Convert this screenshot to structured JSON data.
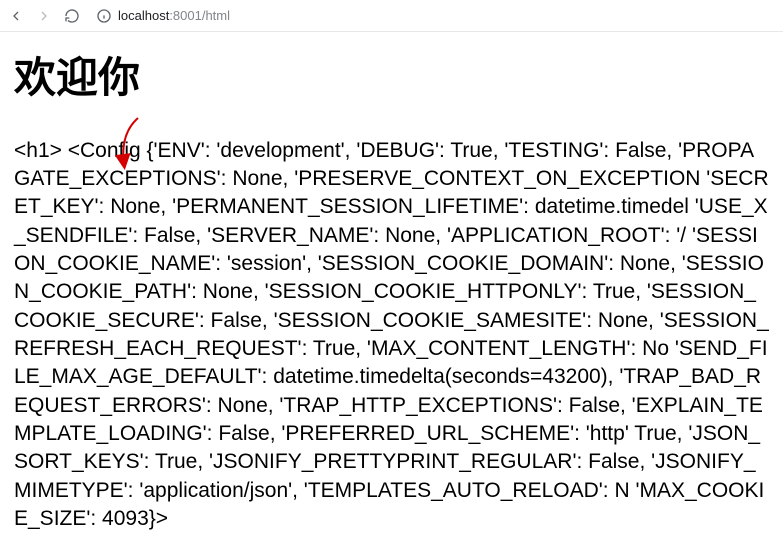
{
  "browser": {
    "url_host": "localhost",
    "url_port_path": ":8001/html"
  },
  "page": {
    "heading": "欢迎你",
    "config_text": "<h1> <Config {'ENV': 'development', 'DEBUG': True, 'TESTING': False, 'PROPAGATE_EXCEPTIONS': None, 'PRESERVE_CONTEXT_ON_EXCEPTION 'SECRET_KEY': None, 'PERMANENT_SESSION_LIFETIME': datetime.timedel 'USE_X_SENDFILE': False, 'SERVER_NAME': None, 'APPLICATION_ROOT': '/ 'SESSION_COOKIE_NAME': 'session', 'SESSION_COOKIE_DOMAIN': None, 'SESSION_COOKIE_PATH': None, 'SESSION_COOKIE_HTTPONLY': True, 'SESSION_COOKIE_SECURE': False, 'SESSION_COOKIE_SAMESITE': None, 'SESSION_REFRESH_EACH_REQUEST': True, 'MAX_CONTENT_LENGTH': No 'SEND_FILE_MAX_AGE_DEFAULT': datetime.timedelta(seconds=43200), 'TRAP_BAD_REQUEST_ERRORS': None, 'TRAP_HTTP_EXCEPTIONS': False, 'EXPLAIN_TEMPLATE_LOADING': False, 'PREFERRED_URL_SCHEME': 'http' True, 'JSON_SORT_KEYS': True, 'JSONIFY_PRETTYPRINT_REGULAR': False, 'JSONIFY_MIMETYPE': 'application/json', 'TEMPLATES_AUTO_RELOAD': N 'MAX_COOKIE_SIZE': 4093}>"
  },
  "annotation": {
    "arrow_color": "#d40000"
  }
}
